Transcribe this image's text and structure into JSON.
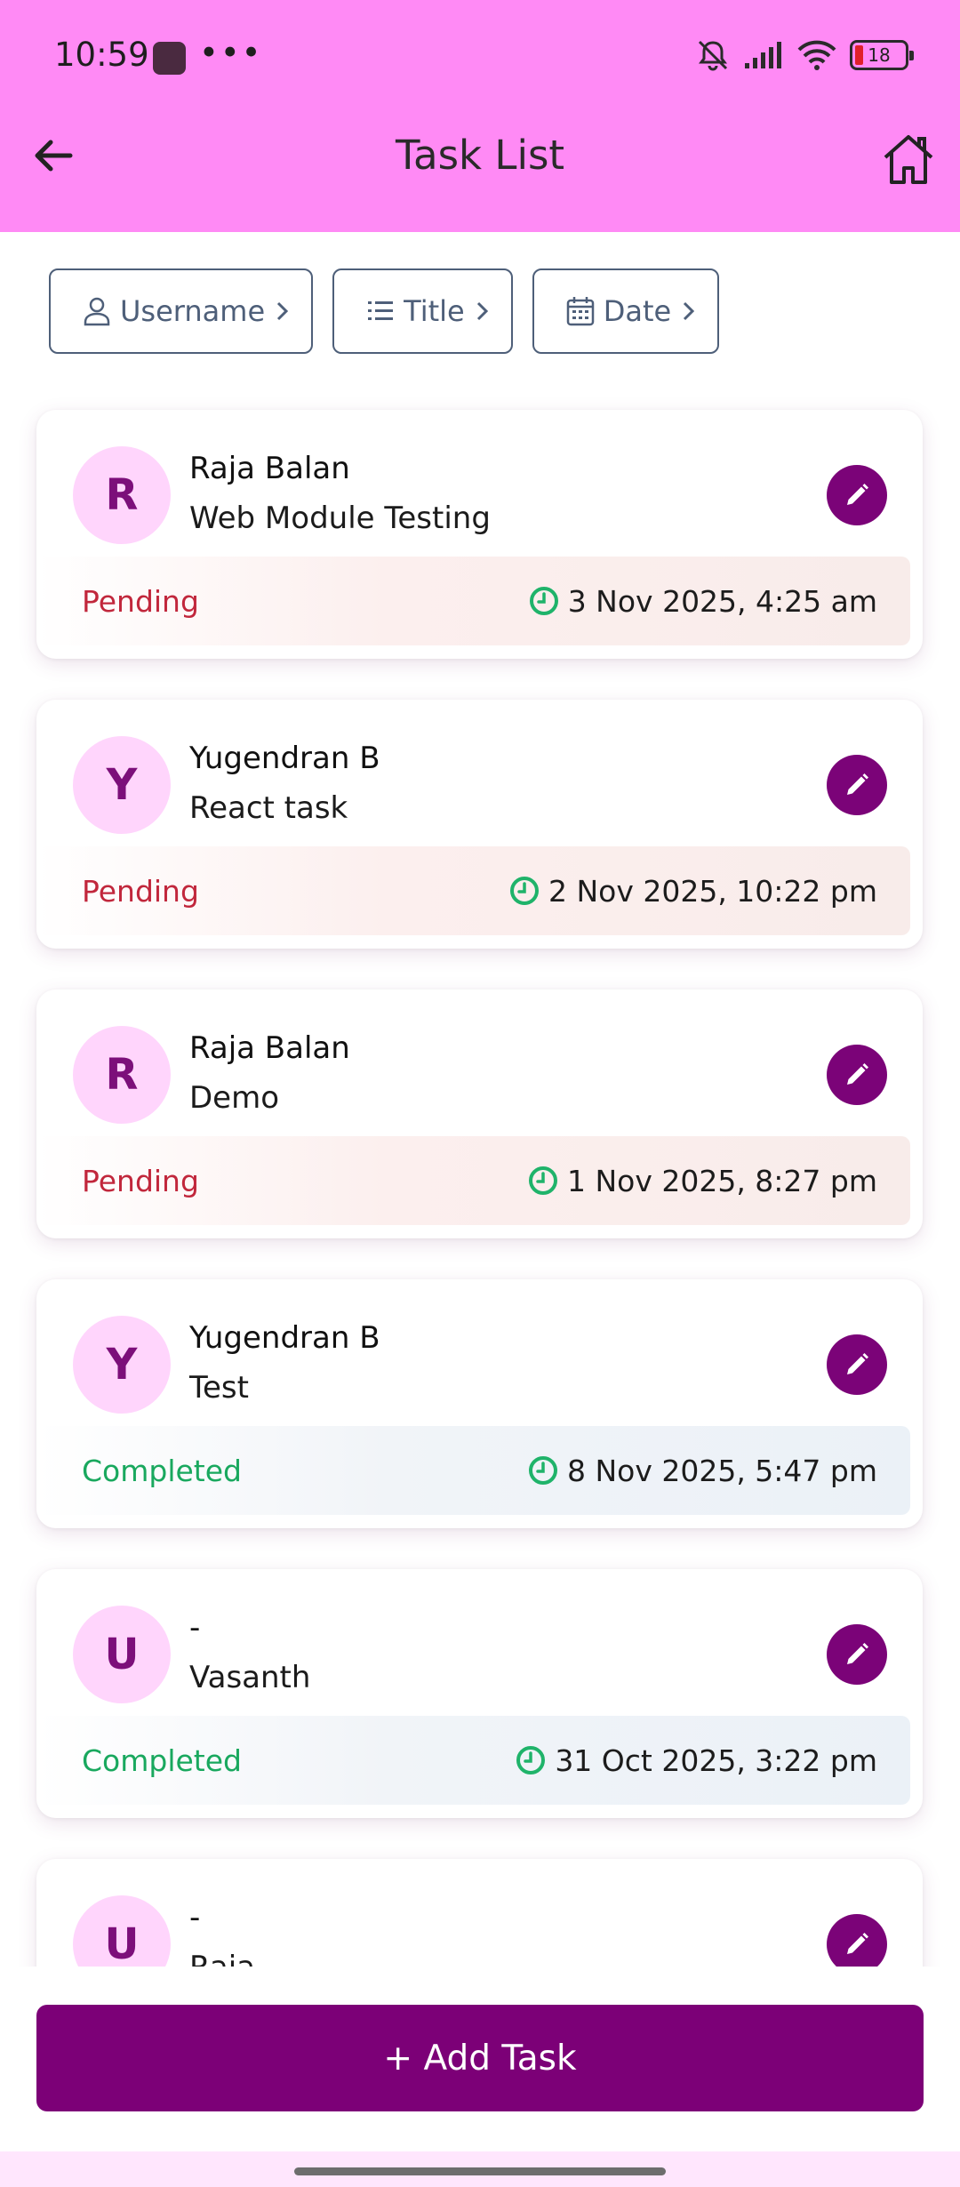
{
  "status_bar": {
    "time": "10:59",
    "more": "•••",
    "battery": "18",
    "icons": [
      "app-icon",
      "mute-icon",
      "signal-icon",
      "wifi-icon",
      "battery-icon"
    ]
  },
  "header": {
    "title": "Task List",
    "back_icon": "arrow-left-icon",
    "home_icon": "home-icon",
    "background": "#ff8af5"
  },
  "filters": [
    {
      "label": "Username",
      "icon": "user-icon"
    },
    {
      "label": "Title",
      "icon": "list-icon"
    },
    {
      "label": "Date",
      "icon": "calendar-icon"
    }
  ],
  "tasks": [
    {
      "initial": "R",
      "username": "Raja Balan",
      "title": "Web Module Testing",
      "status": "Pending",
      "datetime": "3 Nov 2025, 4:25 am"
    },
    {
      "initial": "Y",
      "username": "Yugendran B",
      "title": "React task",
      "status": "Pending",
      "datetime": "2 Nov 2025, 10:22 pm"
    },
    {
      "initial": "R",
      "username": "Raja Balan",
      "title": "Demo",
      "status": "Pending",
      "datetime": "1 Nov 2025, 8:27 pm"
    },
    {
      "initial": "Y",
      "username": "Yugendran B",
      "title": "Test",
      "status": "Completed",
      "datetime": "8 Nov 2025, 5:47 pm"
    },
    {
      "initial": "U",
      "username": "-",
      "title": "Vasanth",
      "status": "Completed",
      "datetime": "31 Oct 2025, 3:22 pm"
    },
    {
      "initial": "U",
      "username": "-",
      "title": "Raja",
      "status": "",
      "datetime": ""
    }
  ],
  "add_button": {
    "label": "+ Add Task"
  },
  "colors": {
    "accent": "#7c0077",
    "pending": "#c1273c",
    "completed": "#19a85e",
    "avatar_bg": "#ffd5fc",
    "clock": "#1fb36a"
  }
}
